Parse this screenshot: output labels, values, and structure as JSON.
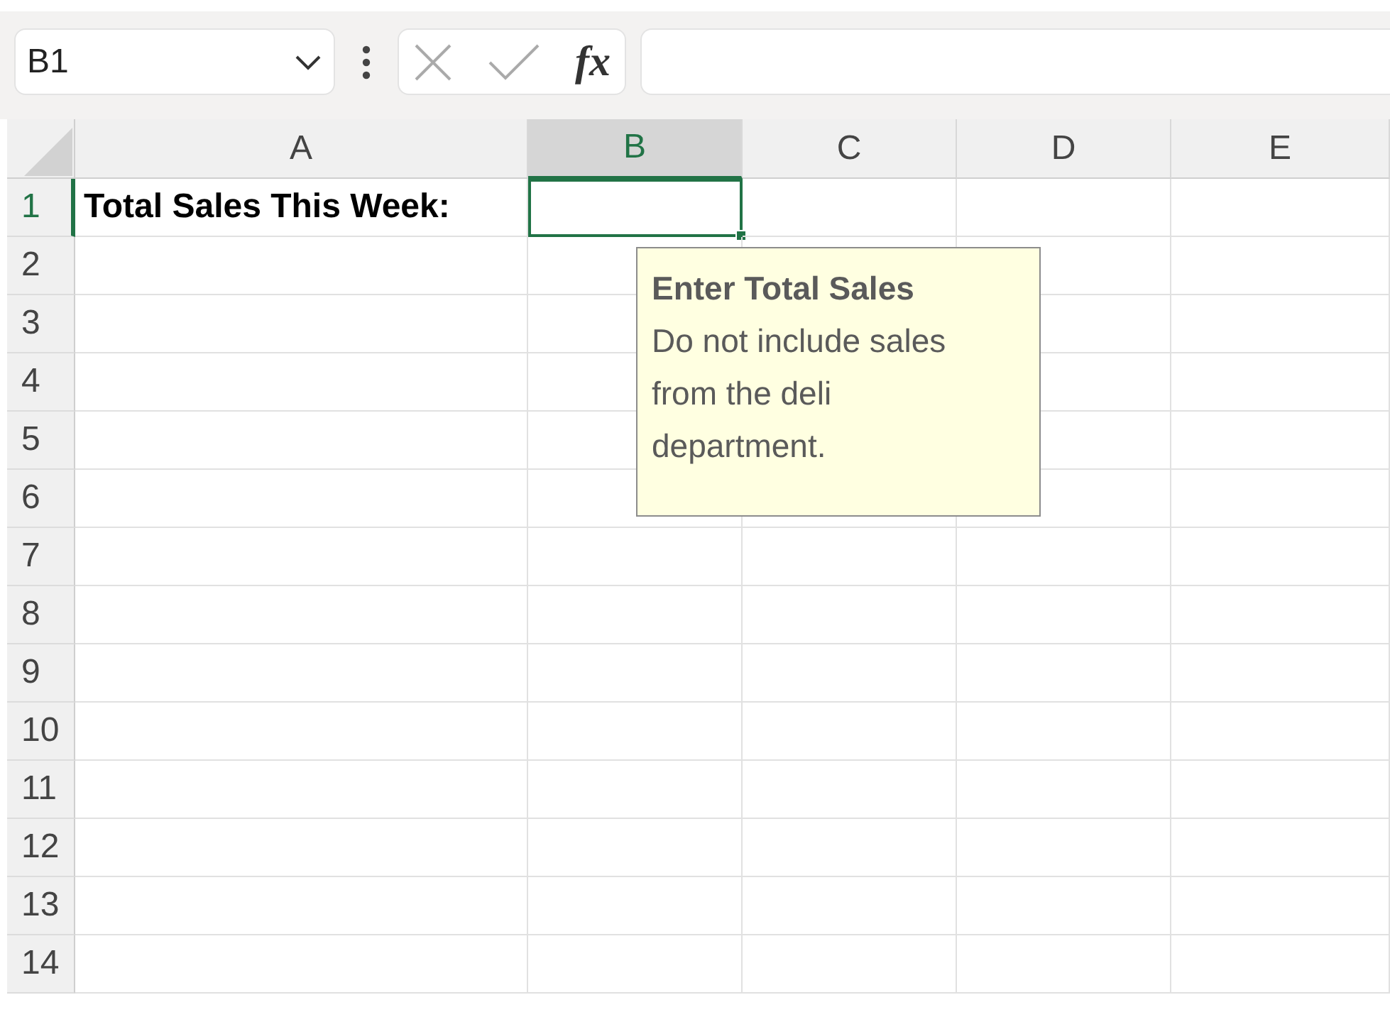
{
  "name_box": {
    "value": "B1"
  },
  "formula_bar": {
    "function_label": "fx"
  },
  "columns": [
    {
      "label": "A",
      "selected": false
    },
    {
      "label": "B",
      "selected": true
    },
    {
      "label": "C",
      "selected": false
    },
    {
      "label": "D",
      "selected": false
    },
    {
      "label": "E",
      "selected": false
    }
  ],
  "rows": [
    {
      "label": "1",
      "selected": true,
      "cells": [
        {
          "text": "Total Sales This Week:",
          "selected": false
        },
        {
          "selected": true
        },
        {
          "selected": false
        },
        {
          "selected": false
        },
        {
          "selected": false
        }
      ]
    },
    {
      "label": "2",
      "selected": false
    },
    {
      "label": "3",
      "selected": false
    },
    {
      "label": "4",
      "selected": false
    },
    {
      "label": "5",
      "selected": false
    },
    {
      "label": "6",
      "selected": false
    },
    {
      "label": "7",
      "selected": false
    },
    {
      "label": "8",
      "selected": false
    },
    {
      "label": "9",
      "selected": false
    },
    {
      "label": "10",
      "selected": false
    },
    {
      "label": "11",
      "selected": false
    },
    {
      "label": "12",
      "selected": false
    },
    {
      "label": "13",
      "selected": false
    },
    {
      "label": "14",
      "selected": false
    }
  ],
  "input_message": {
    "title": "Enter Total Sales",
    "message": "Do not include sales from the deli department."
  }
}
